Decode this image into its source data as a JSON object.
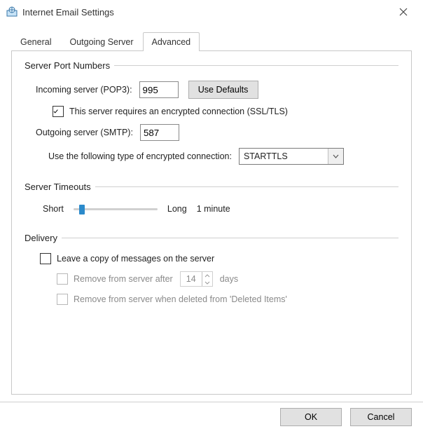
{
  "window": {
    "title": "Internet Email Settings"
  },
  "tabs": {
    "general": "General",
    "outgoing": "Outgoing Server",
    "advanced": "Advanced"
  },
  "groups": {
    "ports_legend": "Server Port Numbers",
    "timeouts_legend": "Server Timeouts",
    "delivery_legend": "Delivery"
  },
  "ports": {
    "incoming_label": "Incoming server (POP3):",
    "incoming_value": "995",
    "defaults_btn": "Use Defaults",
    "ssl_chk_label": "This server requires an encrypted connection (SSL/TLS)",
    "ssl_checked": true,
    "outgoing_label": "Outgoing server (SMTP):",
    "outgoing_value": "587",
    "enc_type_label": "Use the following type of encrypted connection:",
    "enc_type_value": "STARTTLS"
  },
  "timeouts": {
    "short_label": "Short",
    "long_label": "Long",
    "value_label": "1 minute",
    "slider_percent": 7
  },
  "delivery": {
    "leave_copy_label": "Leave a copy of messages on the server",
    "leave_copy_checked": false,
    "remove_after_label": "Remove from server after",
    "remove_after_value": "14",
    "remove_after_unit": "days",
    "remove_deleted_label": "Remove from server when deleted from 'Deleted Items'"
  },
  "footer": {
    "ok": "OK",
    "cancel": "Cancel"
  }
}
